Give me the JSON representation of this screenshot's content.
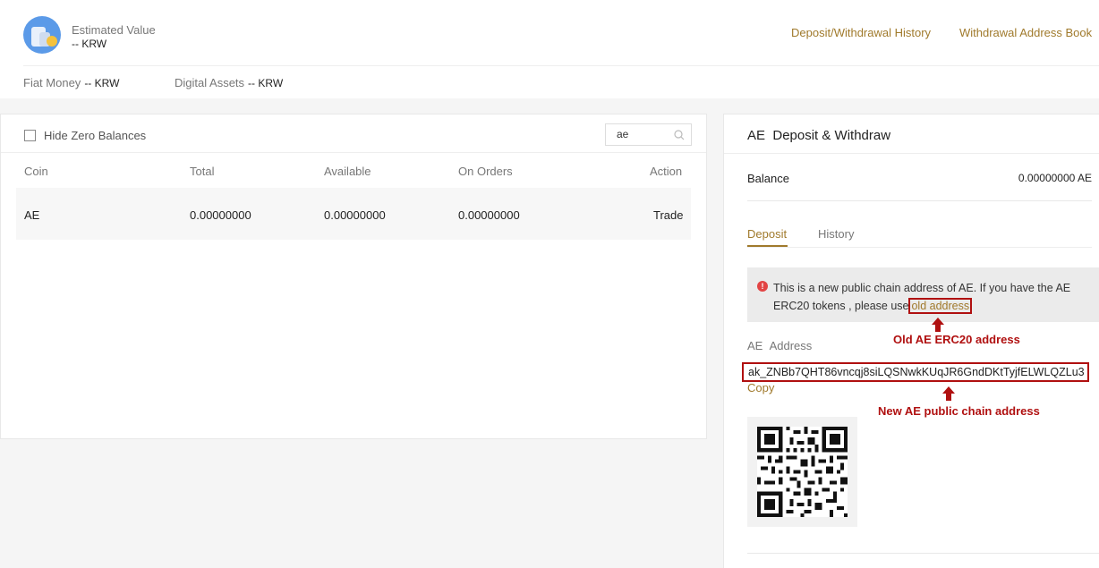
{
  "header": {
    "estimated_label": "Estimated Value",
    "estimated_value": "-- KRW",
    "links": [
      "Deposit/Withdrawal History",
      "Withdrawal Address Book"
    ],
    "fiat_label": "Fiat Money",
    "fiat_value": "-- KRW",
    "digital_label": "Digital Assets",
    "digital_value": "-- KRW"
  },
  "balances": {
    "hide_zero_label": "Hide Zero Balances",
    "search_value": "ae",
    "columns": [
      "Coin",
      "Total",
      "Available",
      "On Orders",
      "Action"
    ],
    "rows": [
      {
        "coin": "AE",
        "total": "0.00000000",
        "available": "0.00000000",
        "on_orders": "0.00000000",
        "action": "Trade"
      }
    ]
  },
  "deposit_panel": {
    "coin": "AE",
    "title": "Deposit & Withdraw",
    "balance_label": "Balance",
    "balance_value": "0.00000000 AE",
    "tabs": [
      "Deposit",
      "History"
    ],
    "notice_text": "This is a new public chain address of AE. If you have the AE ERC20 tokens , please use",
    "notice_link": "old address",
    "address_label_coin": "AE",
    "address_label": "Address",
    "address": "ak_ZNBb7QHT86vncqj8siLQSNwkKUqJR6GndDKtTyjfELWLQZLu3",
    "copy_label": "Copy"
  },
  "annotations": {
    "old": "Old AE ERC20 address",
    "new": "New AE public chain address",
    "color": "#b01010"
  },
  "colors": {
    "accent": "#a07a2c",
    "error": "#e24444"
  }
}
